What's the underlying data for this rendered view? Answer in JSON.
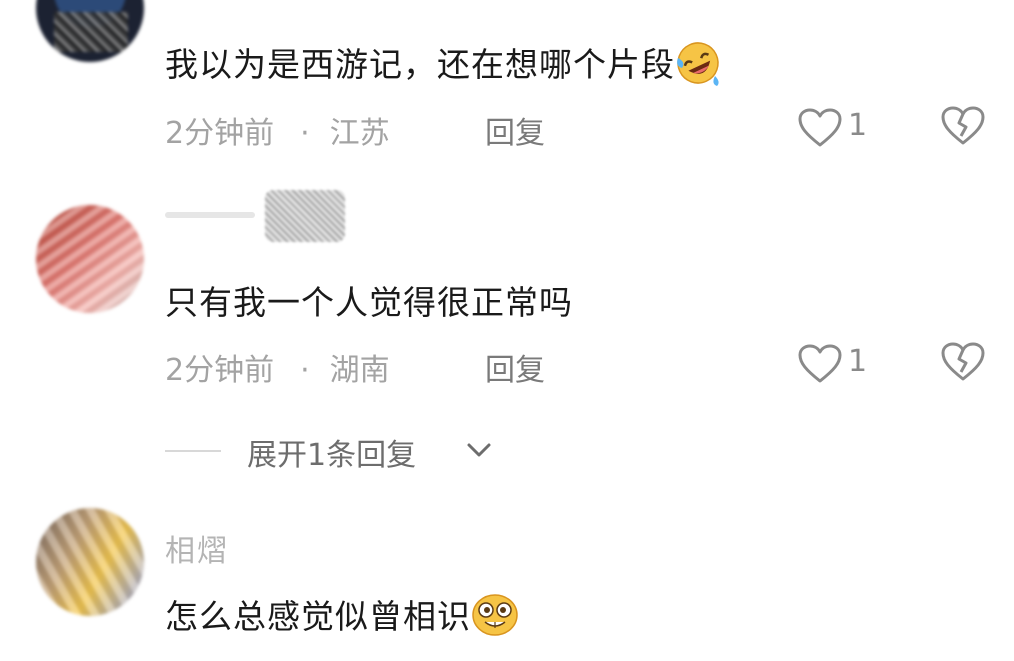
{
  "comments": [
    {
      "username": "",
      "content": "我以为是西游记，还在想哪个片段",
      "emoji_icon": "rolling-laughing-emoji",
      "time": "2分钟前",
      "separator": "·",
      "location": "江苏",
      "reply_label": "回复",
      "like_count": "1"
    },
    {
      "username": "",
      "content": "只有我一个人觉得很正常吗",
      "time": "2分钟前",
      "separator": "·",
      "location": "湖南",
      "reply_label": "回复",
      "like_count": "1",
      "expand_replies_label": "展开1条回复"
    },
    {
      "username": "相熠",
      "content": "怎么总感觉似曾相识",
      "emoji_icon": "grinning-emoji"
    }
  ],
  "colors": {
    "text_primary": "#1a1a1a",
    "text_secondary": "#a3a3a3",
    "icon_gray": "#8a8a8a"
  }
}
